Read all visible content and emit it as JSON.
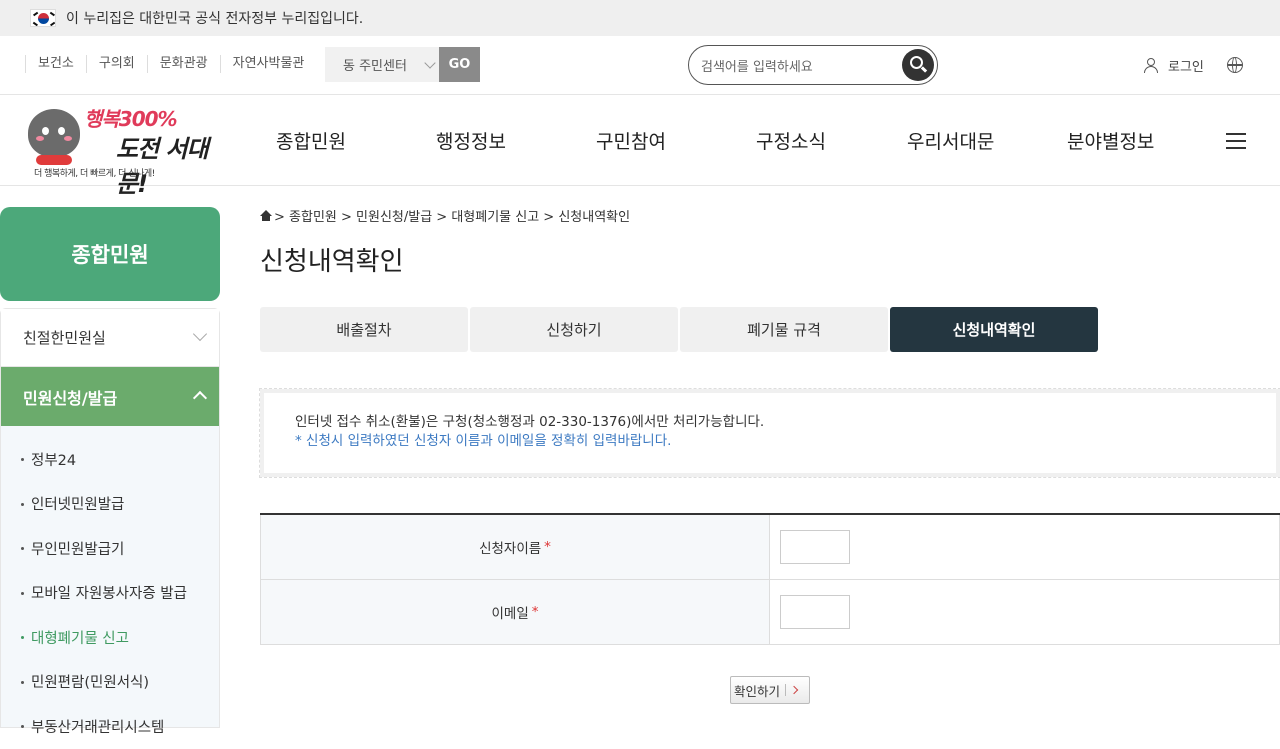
{
  "gov_banner": {
    "text": "이 누리집은 대한민국 공식 전자정부 누리집입니다."
  },
  "utility": {
    "links": [
      "보건소",
      "구의회",
      "문화관광",
      "자연사박물관"
    ],
    "dong_select": "동 주민센터",
    "go_label": "GO",
    "search_placeholder": "검색어를 입력하세요",
    "login_label": "로그인"
  },
  "logo": {
    "line1": "행복300%",
    "line2": "도전 서대문!",
    "tagline": "더 행복하게, 더 빠르게, 더 신나게!"
  },
  "gnb": [
    "종합민원",
    "행정정보",
    "구민참여",
    "구정소식",
    "우리서대문",
    "분야별정보"
  ],
  "sidebar": {
    "title": "종합민원",
    "group1": "친절한민원실",
    "group2": "민원신청/발급",
    "sub_items": [
      "정부24",
      "인터넷민원발급",
      "무인민원발급기",
      "모바일 자원봉사자증 발급",
      "대형폐기물 신고",
      "민원편람(민원서식)",
      "부동산거래관리시스템"
    ]
  },
  "breadcrumb": "> 종합민원 > 민원신청/발급 > 대형폐기물 신고 > 신청내역확인",
  "page_title": "신청내역확인",
  "tabs": [
    "배출절차",
    "신청하기",
    "폐기물 규격",
    "신청내역확인"
  ],
  "notice": {
    "line1": "인터넷 접수 취소(환불)은 구청(청소행정과 02-330-1376)에서만 처리가능합니다.",
    "line2": "* 신청시 입력하였던 신청자 이름과 이메일을 정확히 입력바랍니다."
  },
  "form": {
    "name_label": "신청자이름",
    "email_label": "이메일",
    "required_mark": "*",
    "name_value": "",
    "email_value": ""
  },
  "confirm_label": "확인하기",
  "colors": {
    "sidebar_title": "#4ca87a",
    "sidebar_active": "#6bab6c",
    "tab_active": "#243640",
    "notice_blue": "#3d7ac2"
  }
}
